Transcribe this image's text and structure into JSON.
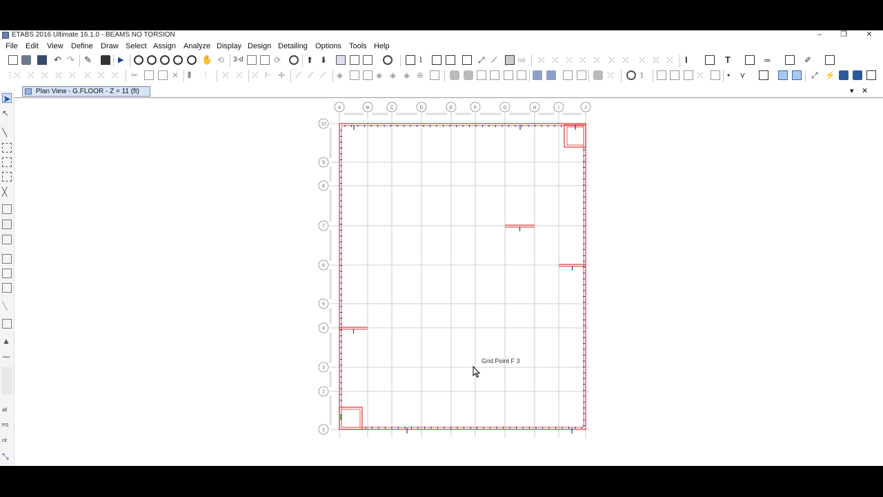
{
  "window": {
    "title": "ETABS 2016 Ultimate 16.1.0 - BEAMS NO TORSION",
    "controls": {
      "minimize": "–",
      "restore": "❐",
      "close": "✕"
    }
  },
  "menu": [
    "File",
    "Edit",
    "View",
    "Define",
    "Draw",
    "Select",
    "Assign",
    "Analyze",
    "Display",
    "Design",
    "Detailing",
    "Options",
    "Tools",
    "Help"
  ],
  "toolbar": {
    "three_d_label": "3-d",
    "nd_label": "nd"
  },
  "tab": {
    "label": "Plan View - G.FLOOR - Z = 11 (ft)",
    "dropdown": "▾",
    "close": "✕"
  },
  "plan": {
    "grid_columns": [
      "A",
      "B",
      "C",
      "D",
      "E",
      "F",
      "G",
      "H",
      "I",
      "J"
    ],
    "grid_rows": [
      "1",
      "2",
      "3",
      "4",
      "5",
      "6",
      "7",
      "8",
      "9",
      "10"
    ],
    "colors": {
      "beam": "#e03030",
      "grid": "#bfbfbf",
      "support": "#2a2aa0",
      "bubble": "#888888"
    }
  },
  "left_toolbar": {
    "all_label": "all",
    "ps_label": "PS",
    "clr_label": "clr"
  },
  "status": {
    "grid_point_label": "Grid Point  F  3"
  }
}
